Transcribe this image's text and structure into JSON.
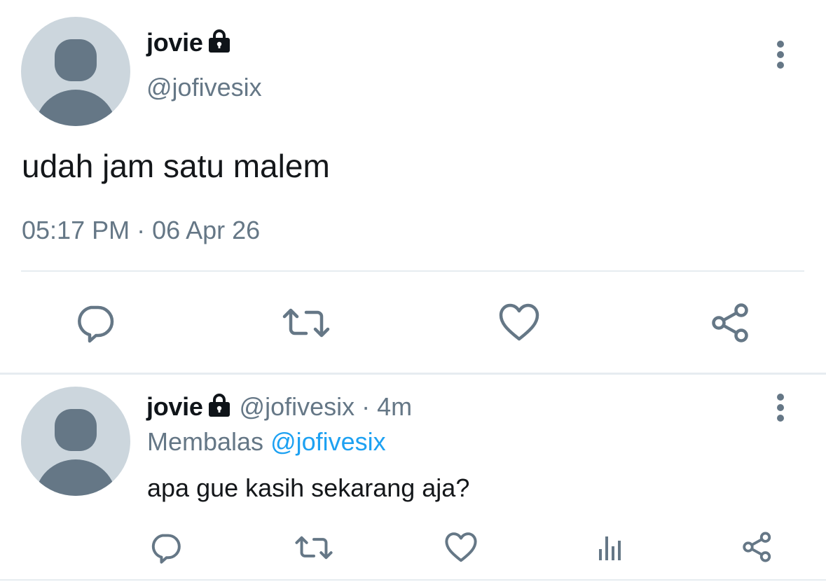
{
  "colors": {
    "text_primary": "#0f1419",
    "text_secondary": "#657786",
    "link": "#1da1f2",
    "divider": "#e6ecf0",
    "avatar_bg": "#ccd6dd",
    "avatar_fg": "#657786"
  },
  "main_tweet": {
    "display_name": "jovie",
    "protected_icon": "lock-icon",
    "handle": "@jofivesix",
    "text": "udah jam satu malem",
    "timestamp": "05:17 PM · 06 Apr 26",
    "more_icon": "more-vertical-icon",
    "actions": [
      {
        "icon": "reply-icon"
      },
      {
        "icon": "retweet-icon"
      },
      {
        "icon": "heart-icon"
      },
      {
        "icon": "share-icon"
      }
    ]
  },
  "reply_tweet": {
    "display_name": "jovie",
    "protected_icon": "lock-icon",
    "handle": "@jofivesix",
    "time_ago": "· 4m",
    "replying_label": "Membalas",
    "replying_to": "@jofivesix",
    "text": "apa gue kasih sekarang aja?",
    "more_icon": "more-vertical-icon",
    "actions": [
      {
        "icon": "reply-icon"
      },
      {
        "icon": "retweet-icon"
      },
      {
        "icon": "heart-icon"
      },
      {
        "icon": "analytics-icon"
      },
      {
        "icon": "share-icon"
      }
    ]
  }
}
